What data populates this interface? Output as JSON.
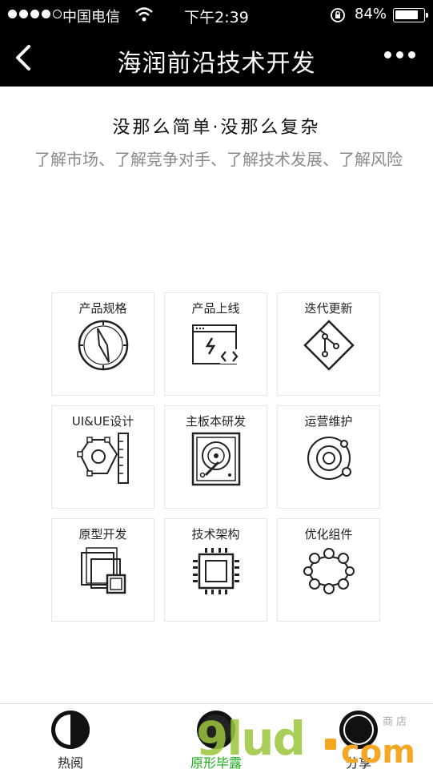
{
  "status_bar": {
    "carrier": "中国电信",
    "time": "下午2:39",
    "battery": "84%",
    "battery_level": 0.84
  },
  "nav": {
    "title": "海润前沿技术开发"
  },
  "intro": {
    "headline": "没那么简单·没那么复杂",
    "subline": "了解市场、了解竞争对手、了解技术发展、了解风险"
  },
  "services": [
    {
      "label": "产品规格",
      "icon": "compass-icon"
    },
    {
      "label": "产品上线",
      "icon": "browser-code-icon"
    },
    {
      "label": "迭代更新",
      "icon": "git-branch-icon"
    },
    {
      "label": "UI&UE设计",
      "icon": "vector-ruler-icon"
    },
    {
      "label": "主板本研发",
      "icon": "hard-disk-icon"
    },
    {
      "label": "运营维护",
      "icon": "orbit-icon"
    },
    {
      "label": "原型开发",
      "icon": "layered-frames-icon"
    },
    {
      "label": "技术架构",
      "icon": "chip-icon"
    },
    {
      "label": "优化组件",
      "icon": "node-ring-icon"
    }
  ],
  "tabs": [
    {
      "label": "热阅",
      "active": false
    },
    {
      "label": "原形毕露",
      "active": true
    },
    {
      "label": "分享",
      "active": false
    }
  ],
  "colors": {
    "active_tab": "#1aad19",
    "bar_bg": "#000000"
  },
  "watermark": {
    "main": "9lud",
    "tld": "com",
    "sub": "商店"
  }
}
